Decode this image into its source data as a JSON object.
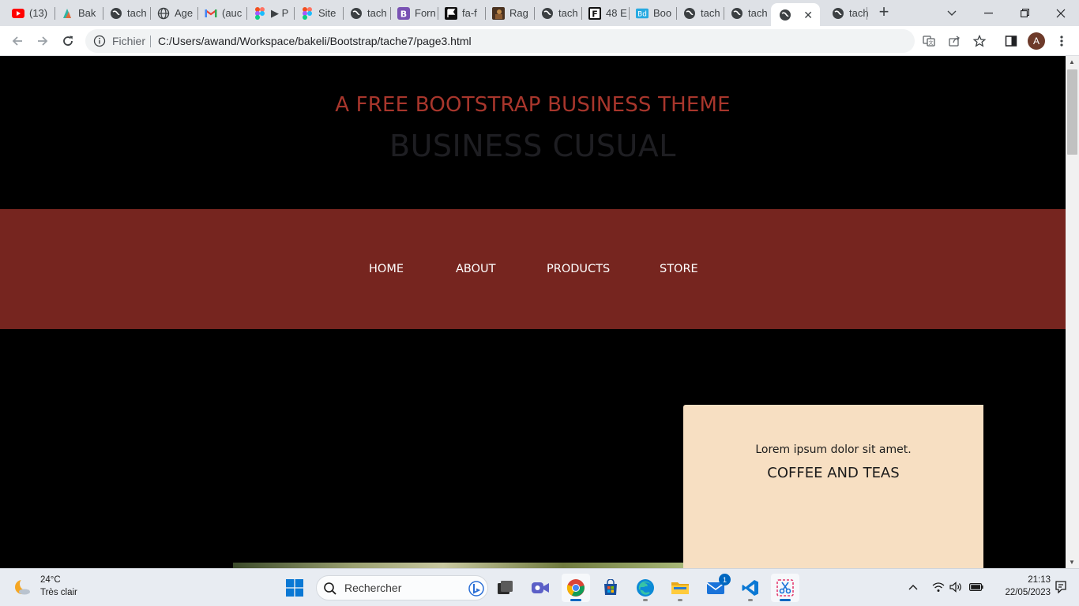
{
  "browser": {
    "tabs": [
      {
        "title": "(13)",
        "icon": "youtube-icon"
      },
      {
        "title": "Bak",
        "icon": "bakeli-icon"
      },
      {
        "title": "tach",
        "icon": "globe-icon"
      },
      {
        "title": "Age",
        "icon": "world-icon"
      },
      {
        "title": "(auc",
        "icon": "gmail-icon"
      },
      {
        "title": "▶ P",
        "icon": "figma-icon"
      },
      {
        "title": "Site",
        "icon": "figma-icon"
      },
      {
        "title": "tach",
        "icon": "globe-icon"
      },
      {
        "title": "Forn",
        "icon": "bootstrap-icon"
      },
      {
        "title": "fa-f",
        "icon": "flag-icon"
      },
      {
        "title": "Rag",
        "icon": "image-icon"
      },
      {
        "title": "tach",
        "icon": "globe-icon"
      },
      {
        "title": "48 E",
        "icon": "font-icon"
      },
      {
        "title": "Boo",
        "icon": "bd-icon"
      },
      {
        "title": "tach",
        "icon": "globe-icon"
      },
      {
        "title": "tach",
        "icon": "globe-icon"
      },
      {
        "title": "",
        "icon": "globe-icon",
        "active": true
      },
      {
        "title": "tach",
        "icon": "globe-icon"
      }
    ],
    "omnibox": {
      "scheme_label": "Fichier",
      "url": "C:/Users/awand/Workspace/bakeli/Bootstrap/tache7/page3.html"
    },
    "profile_initial": "A"
  },
  "page": {
    "subtitle": "A FREE BOOTSTRAP BUSINESS THEME",
    "title": "BUSINESS CUSUAL",
    "nav": [
      "HOME",
      "ABOUT",
      "PRODUCTS",
      "STORE"
    ],
    "card": {
      "lead": "Lorem ipsum dolor sit amet.",
      "heading": "COFFEE AND TEAS"
    },
    "colors": {
      "subtitle": "#a8362c",
      "title": "#1e1e22",
      "nav_band": "#76251f",
      "card_bg": "#f7dfc2"
    }
  },
  "taskbar": {
    "weather": {
      "temp": "24°C",
      "desc": "Très clair"
    },
    "search_placeholder": "Rechercher",
    "mail_badge": "1",
    "clock": {
      "time": "21:13",
      "date": "22/05/2023"
    }
  }
}
